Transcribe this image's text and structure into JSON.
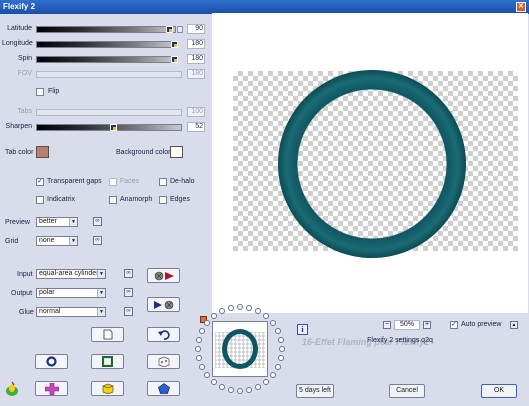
{
  "window": {
    "title": "Flexify 2"
  },
  "params": {
    "latitude": {
      "label": "Latitude",
      "value": "90",
      "level": 0.92
    },
    "longitude": {
      "label": "Longitude",
      "value": "180",
      "level": 0.96
    },
    "spin": {
      "label": "Spin",
      "value": "180",
      "level": 0.96
    },
    "fov": {
      "label": "FOV",
      "value": "180"
    },
    "flip": {
      "label": "Flip"
    },
    "tabs": {
      "label": "Tabs",
      "value": "100"
    },
    "sharpen": {
      "label": "Sharpen",
      "value": "52",
      "level": 0.52
    }
  },
  "colors": {
    "tab_color_label": "Tab color",
    "tab_color": "#b88070",
    "background_color_label": "Background color",
    "background_color": "#ffffff"
  },
  "options": {
    "transparent_gaps": {
      "label": "Transparent gaps",
      "checked": true
    },
    "faces": {
      "label": "Faces"
    },
    "de_halo": {
      "label": "De-halo"
    },
    "indicatrix": {
      "label": "Indicatrix"
    },
    "anamorph": {
      "label": "Anamorph"
    },
    "edges": {
      "label": "Edges"
    }
  },
  "selects": {
    "preview": {
      "label": "Preview",
      "value": "better"
    },
    "grid": {
      "label": "Grid",
      "value": "none"
    },
    "input": {
      "label": "Input",
      "value": "equal-area cylinder"
    },
    "output": {
      "label": "Output",
      "value": "polar"
    },
    "glue": {
      "label": "Glue",
      "value": "normal"
    }
  },
  "preview_panel": {
    "zoom": "50%",
    "auto_preview_label": "Auto preview",
    "auto_preview_checked": true,
    "settings_name": "Flexify 2 settings q2q",
    "watermark": "16-Effet Flaming pear Flexify2",
    "ring_color": "#0f5662"
  },
  "buttons": {
    "days_left": "5 days left",
    "cancel": "Cancel",
    "ok": "OK"
  },
  "icons": {
    "title_close": "close-icon",
    "info": "info-icon",
    "zoom_minus": "minus-icon",
    "zoom_plus": "plus-icon"
  }
}
